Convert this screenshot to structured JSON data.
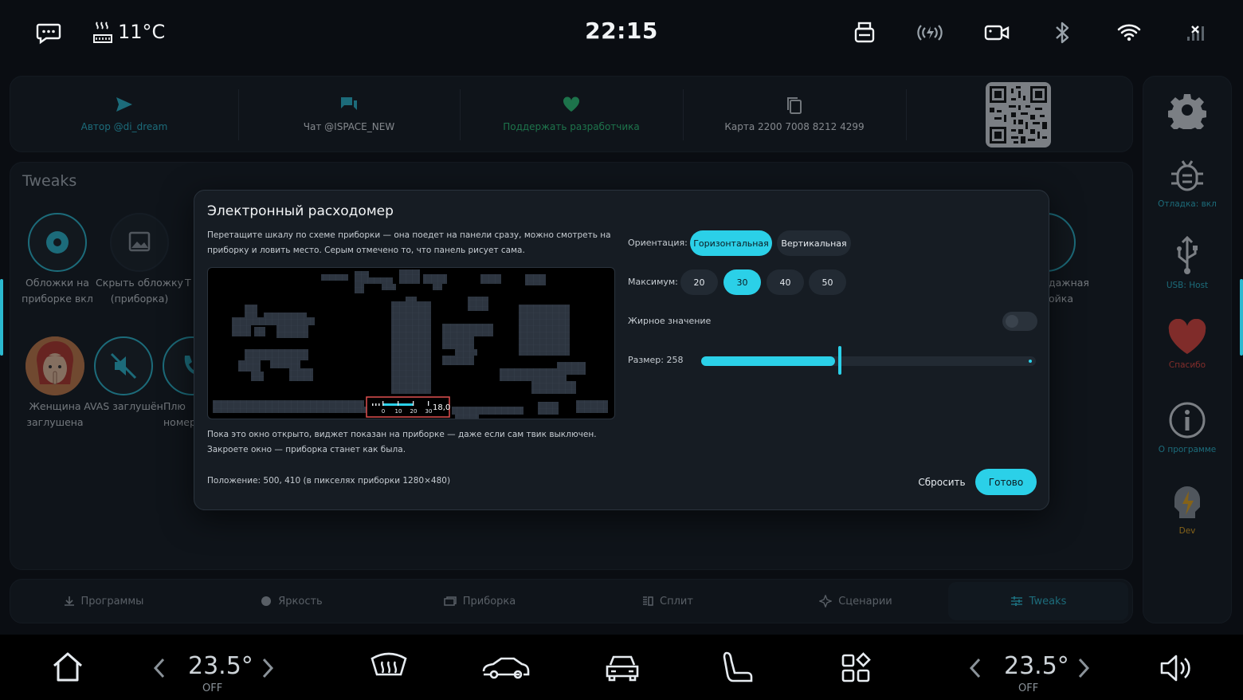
{
  "status": {
    "outside_temp": "11°C",
    "time": "22:15"
  },
  "links": [
    {
      "label": "Автор @di_dream",
      "icon": "send-icon",
      "color": "#2bb9cf"
    },
    {
      "label": "Чат @ISPACE_NEW",
      "icon": "chat-icon",
      "color": "#2bb9cf"
    },
    {
      "label": "Поддержать разработчика",
      "icon": "heart-icon",
      "color": "#2ec77a"
    },
    {
      "label": "Карта 2200 7008 8212 4299",
      "icon": "copy-icon",
      "color": "#c6ccd2"
    }
  ],
  "tweaks": {
    "title": "Tweaks",
    "items": [
      {
        "label": "Обложки на приборке вкл"
      },
      {
        "label": "Скрыть обложку (приборка)"
      },
      {
        "label": "Женщина заглушена"
      },
      {
        "label": "AVAS заглушён"
      },
      {
        "label": "Плю номер"
      },
      {
        "label": "Т"
      },
      {
        "label": "дажная ойка"
      }
    ]
  },
  "tabs": [
    {
      "label": "Программы",
      "icon": "download-icon"
    },
    {
      "label": "Яркость",
      "icon": "brightness-icon"
    },
    {
      "label": "Приборка",
      "icon": "dashboard-icon"
    },
    {
      "label": "Сплит",
      "icon": "split-icon"
    },
    {
      "label": "Сценарии",
      "icon": "sparkle-icon"
    },
    {
      "label": "Tweaks",
      "icon": "sliders-icon",
      "active": true
    }
  ],
  "sidebar": [
    {
      "label": "",
      "icon": "gear-icon"
    },
    {
      "label": "Отладка: вкл",
      "icon": "bug-icon"
    },
    {
      "label": "USB: Host",
      "icon": "usb-icon"
    },
    {
      "label": "Спасибо",
      "icon": "heart-icon",
      "color": "#e2473f"
    },
    {
      "label": "О программе",
      "icon": "info-icon"
    },
    {
      "label": "Dev",
      "icon": "dev-icon",
      "color": "#e8a820"
    }
  ],
  "dock": {
    "left_temp": "23.5°",
    "left_state": "OFF",
    "right_temp": "23.5°",
    "right_state": "OFF"
  },
  "modal": {
    "title": "Электронный расходомер",
    "description": "Перетащите шкалу по схеме приборки — она поедет на панели сразу, можно смотреть на приборку и ловить место. Серым отмечено то, что панель рисует сама.",
    "note": "Пока это окно открыто, виджет показан на приборке — даже если сам твик выключен. Закроете окно — приборка станет как была.",
    "position": "Положение: 500, 410 (в пикселях приборки 1280×480)",
    "widget_ticks": [
      "0",
      "10",
      "20",
      "30"
    ],
    "widget_value": "18,0",
    "orientation_label": "Ориентация:",
    "orientation_options": [
      "Горизонтальная",
      "Вертикальная"
    ],
    "orientation_selected": "Горизонтальная",
    "max_label": "Максимум:",
    "max_options": [
      "20",
      "30",
      "40",
      "50"
    ],
    "max_selected": "30",
    "bold_label": "Жирное значение",
    "bold_enabled": false,
    "size_label": "Размер: 258",
    "size_fraction": 0.4,
    "reset_label": "Сбросить",
    "done_label": "Готово",
    "accent": "#2bd0e8"
  }
}
